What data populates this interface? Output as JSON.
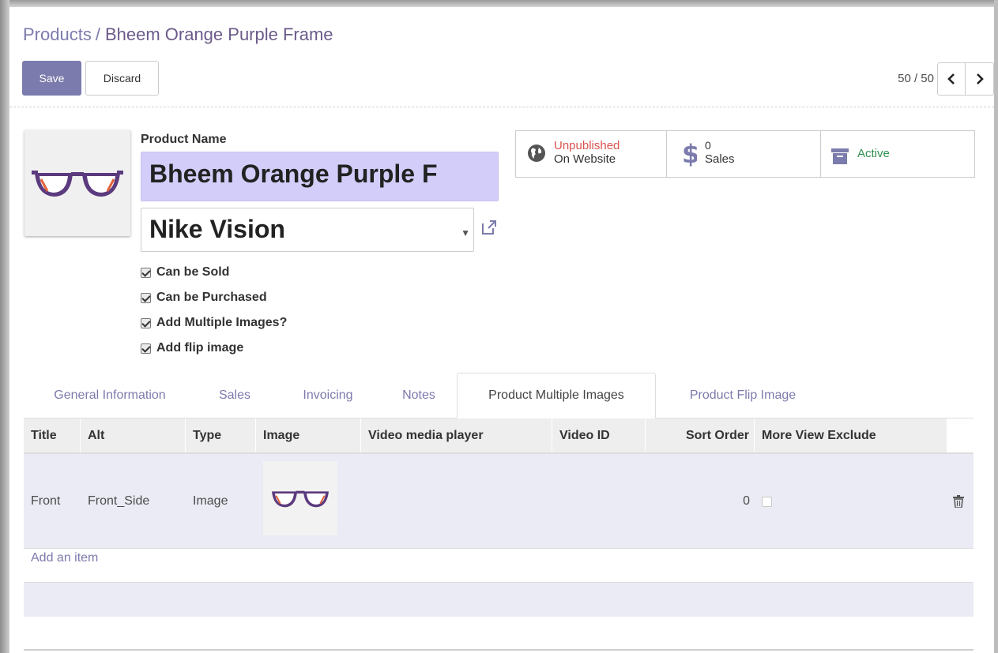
{
  "breadcrumb": {
    "parent": "Products",
    "separator": "/",
    "current": "Bheem Orange Purple Frame"
  },
  "toolbar": {
    "save_label": "Save",
    "discard_label": "Discard"
  },
  "pager": {
    "value": "50 / 50"
  },
  "form": {
    "name_label": "Product Name",
    "name_value": "Bheem Orange Purple F",
    "brand_value": "Nike Vision",
    "checkboxes": [
      {
        "label": "Can be Sold",
        "checked": true
      },
      {
        "label": "Can be Purchased",
        "checked": true
      },
      {
        "label": "Add Multiple Images?",
        "checked": true
      },
      {
        "label": "Add flip image",
        "checked": true
      }
    ]
  },
  "smart_buttons": {
    "website_line1": "Unpublished",
    "website_line2": "On Website",
    "sales_count": "0",
    "sales_label": "Sales",
    "active_label": "Active"
  },
  "tabs": [
    {
      "label": "General Information",
      "active": false
    },
    {
      "label": "Sales",
      "active": false
    },
    {
      "label": "Invoicing",
      "active": false
    },
    {
      "label": "Notes",
      "active": false
    },
    {
      "label": "Product Multiple Images",
      "active": true
    },
    {
      "label": "Product Flip Image",
      "active": false
    }
  ],
  "grid": {
    "columns": [
      "Title",
      "Alt",
      "Type",
      "Image",
      "Video media player",
      "Video ID",
      "Sort Order",
      "More View Exclude"
    ],
    "rows": [
      {
        "title": "Front",
        "alt": "Front_Side",
        "type": "Image",
        "video_player": "",
        "video_id": "",
        "sort_order": "0",
        "exclude": false
      }
    ],
    "add_item_label": "Add an item"
  },
  "colors": {
    "accent": "#7c7bad",
    "name_highlight": "#d2cef9",
    "row_bg": "#eaebf4",
    "header_bg": "#eeeeee",
    "unpublished_red": "#d9534f",
    "active_green": "#2f8f4f",
    "frame_purple": "#5b3a7e",
    "lens_orange": "#e2623a"
  },
  "icons": {
    "website": "globe-icon",
    "sales": "dollar-icon",
    "active": "archive-icon",
    "external": "external-link-icon",
    "delete": "trash-icon",
    "prev": "chevron-left-icon",
    "next": "chevron-right-icon"
  }
}
